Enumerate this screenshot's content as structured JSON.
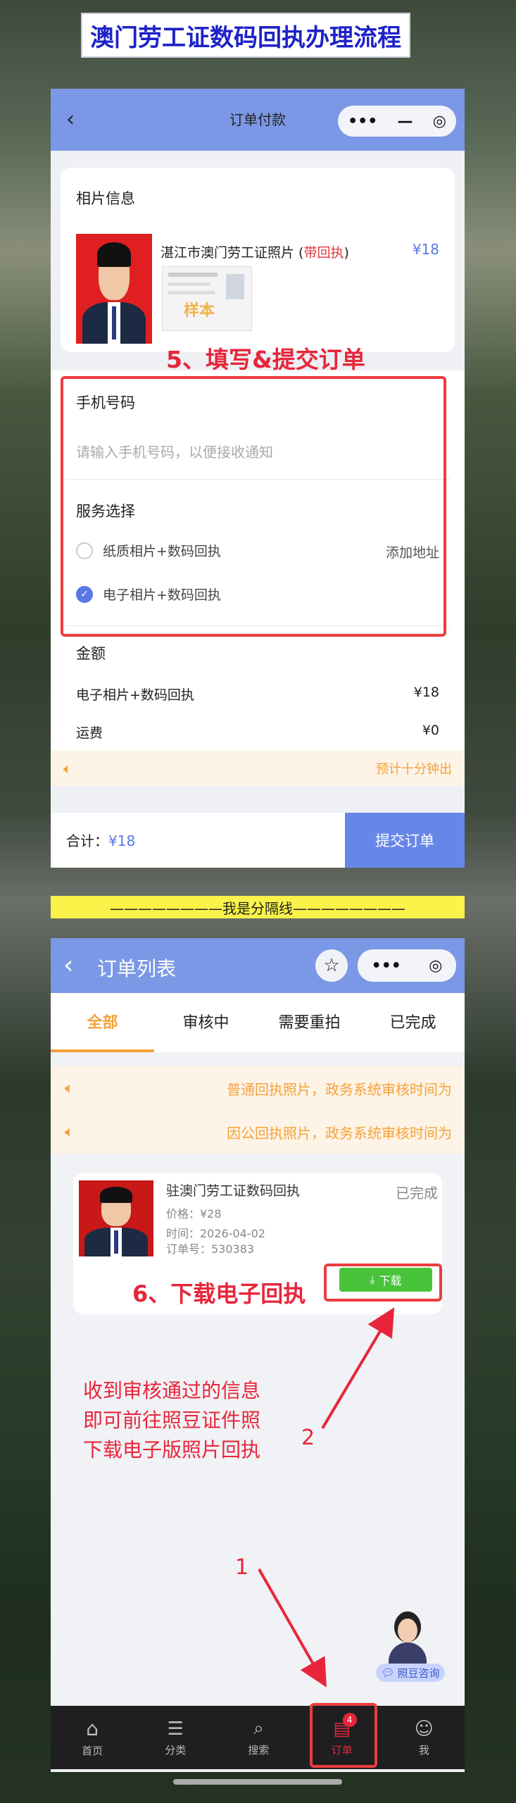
{
  "banner": "澳门劳工证数码回执办理流程",
  "top": {
    "nav_title": "订单付款",
    "capsule": [
      "•••",
      "—",
      "◎"
    ],
    "photo_section": "相片信息",
    "product_name": "湛江市澳门劳工证照片 (",
    "product_tag": "带回执",
    "product_close": ")",
    "product_price": "¥18",
    "stamp": "样本",
    "step5": "5、填写&提交订单",
    "phone_label": "手机号码",
    "phone_placeholder": "请输入手机号码，以便接收通知",
    "service_label": "服务选择",
    "option1": "纸质相片+数码回执",
    "option1_action": "添加地址",
    "option2": "电子相片+数码回执",
    "amount_label": "金额",
    "amount_item": "电子相片+数码回执",
    "amount_item_price": "¥18",
    "shipping": "运费",
    "shipping_price": "¥0",
    "eta": "预计十分钟出",
    "total_label": "合计：",
    "total_value": "¥18",
    "submit": "提交订单"
  },
  "divider": "————————我是分隔线————————",
  "bottom": {
    "nav_title": "订单列表",
    "tabs": [
      "全部",
      "审核中",
      "需要重拍",
      "已完成"
    ],
    "notice1": "普通回执照片，政务系统审核时间为",
    "notice2": "因公回执照片，政务系统审核时间为",
    "order_title": "驻澳门劳工证数码回执",
    "order_status": "已完成",
    "order_price": "价格：¥28",
    "order_time": "时间：2026-04-02",
    "order_no": "订单号：530383",
    "download": "下载",
    "step6": "6、下载电子回执",
    "note_lines": [
      "收到审核通过的信息",
      "即可前往照豆证件照",
      "下载电子版照片回执"
    ],
    "marker2": "2",
    "marker1": "1",
    "consult": "照豆咨询",
    "badge": "4",
    "nav_items": [
      "首页",
      "分类",
      "搜索",
      "订单",
      "我"
    ]
  },
  "colors": {
    "accent": "#5978e6",
    "annotation": "#e8253a",
    "orange": "#f5a23a"
  }
}
